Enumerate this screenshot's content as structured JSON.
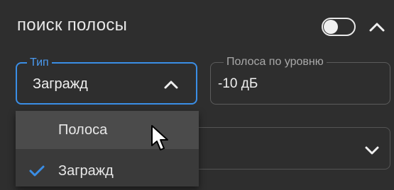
{
  "header": {
    "title": "поиск полосы",
    "toggle_state": "off"
  },
  "type_field": {
    "label": "Тип",
    "value": "Загражд"
  },
  "band_field": {
    "label": "Полоса по уровню",
    "value": "-10 дБ"
  },
  "dropdown": {
    "options": [
      {
        "label": "Полоса",
        "selected": false,
        "hovered": true
      },
      {
        "label": "Загражд",
        "selected": true,
        "hovered": false
      }
    ]
  },
  "colors": {
    "accent": "#3a8ee6",
    "background": "#2e2e2e",
    "menu": "#3a3a3a",
    "menu_hover": "#4b4b4b"
  },
  "icons": [
    "chevron-up-icon",
    "chevron-down-icon",
    "check-icon",
    "mouse-cursor-icon"
  ]
}
